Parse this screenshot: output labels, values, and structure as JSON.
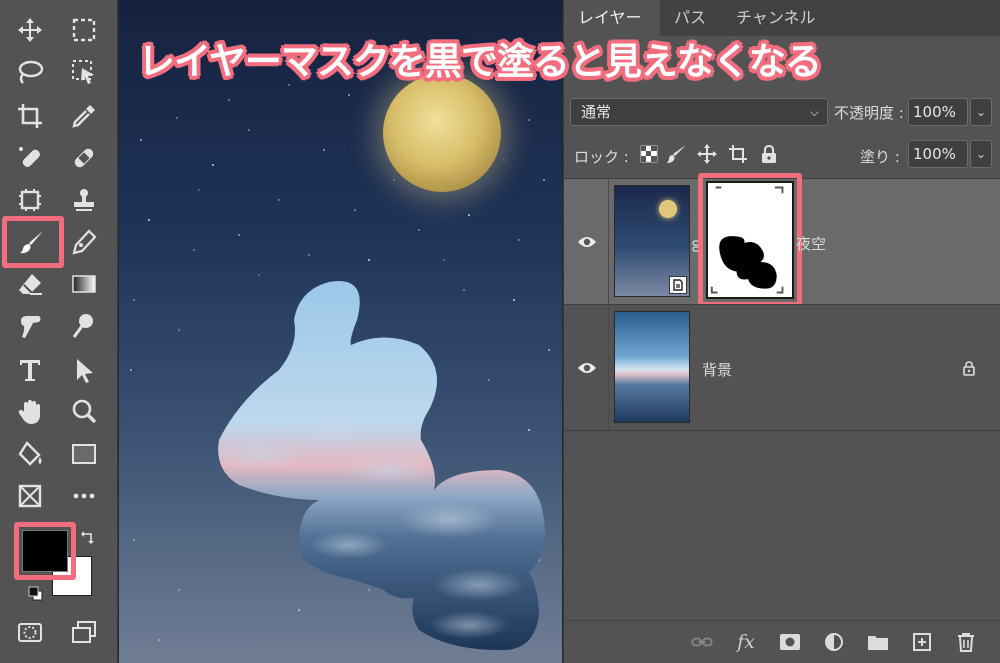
{
  "banner": {
    "text": "レイヤーマスクを黒で塗ると見えなくなる"
  },
  "colors": {
    "highlight": "#f26d7d",
    "panel_bg": "#535353",
    "foreground_color": "#000000",
    "background_color": "#ffffff"
  },
  "toolbar": {
    "tools": [
      {
        "name": "move-icon"
      },
      {
        "name": "marquee-icon"
      },
      {
        "name": "lasso-icon"
      },
      {
        "name": "object-select-icon"
      },
      {
        "name": "crop-icon"
      },
      {
        "name": "eyedropper-icon"
      },
      {
        "name": "spot-heal-icon"
      },
      {
        "name": "bandaid-icon"
      },
      {
        "name": "stamp-select-icon"
      },
      {
        "name": "clone-stamp-icon"
      },
      {
        "name": "brush-icon",
        "selected": true
      },
      {
        "name": "pen-icon"
      },
      {
        "name": "eraser-icon"
      },
      {
        "name": "gradient-icon"
      },
      {
        "name": "smudge-icon"
      },
      {
        "name": "dodge-icon"
      },
      {
        "name": "text-icon"
      },
      {
        "name": "path-select-icon"
      },
      {
        "name": "hand-icon"
      },
      {
        "name": "zoom-icon"
      },
      {
        "name": "paint-bucket-icon"
      },
      {
        "name": "rectangle-icon"
      },
      {
        "name": "frame-icon"
      },
      {
        "name": "more-icon"
      }
    ]
  },
  "panel": {
    "tabs": [
      {
        "label": "レイヤー",
        "active": true
      },
      {
        "label": "パス",
        "active": false
      },
      {
        "label": "チャンネル",
        "active": false
      }
    ],
    "blend_mode": "通常",
    "opacity_label": "不透明度 :",
    "opacity_value": "100%",
    "lock_label": "ロック :",
    "fill_label": "塗り :",
    "fill_value": "100%",
    "layers": [
      {
        "name": "夜空",
        "selected": true,
        "visible": true,
        "has_mask": true
      },
      {
        "name": "背景",
        "selected": false,
        "visible": true,
        "locked": true
      }
    ],
    "footer_icons": [
      "link-icon",
      "fx-icon",
      "add-mask-icon",
      "adjustment-icon",
      "folder-icon",
      "new-layer-icon",
      "trash-icon"
    ],
    "fx_label": "fx"
  }
}
